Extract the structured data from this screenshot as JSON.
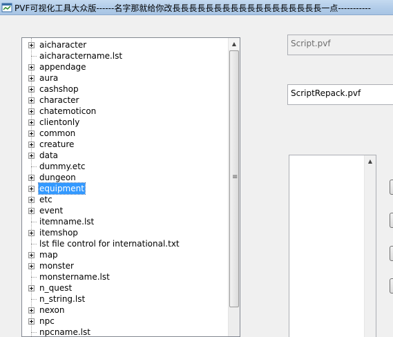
{
  "window": {
    "title": "PVF可视化工具大众版------名字那就给你改長長長長長長長長長長長長長長長長長長一点-----------"
  },
  "tree": {
    "items": [
      {
        "label": "aicharacter",
        "expandable": true,
        "selected": false
      },
      {
        "label": "aicharactername.lst",
        "expandable": false,
        "selected": false
      },
      {
        "label": "appendage",
        "expandable": true,
        "selected": false
      },
      {
        "label": "aura",
        "expandable": true,
        "selected": false
      },
      {
        "label": "cashshop",
        "expandable": true,
        "selected": false
      },
      {
        "label": "character",
        "expandable": true,
        "selected": false
      },
      {
        "label": "chatemoticon",
        "expandable": true,
        "selected": false
      },
      {
        "label": "clientonly",
        "expandable": true,
        "selected": false
      },
      {
        "label": "common",
        "expandable": true,
        "selected": false
      },
      {
        "label": "creature",
        "expandable": true,
        "selected": false
      },
      {
        "label": "data",
        "expandable": true,
        "selected": false
      },
      {
        "label": "dummy.etc",
        "expandable": false,
        "selected": false
      },
      {
        "label": "dungeon",
        "expandable": true,
        "selected": false
      },
      {
        "label": "equipment",
        "expandable": true,
        "selected": true
      },
      {
        "label": "etc",
        "expandable": true,
        "selected": false
      },
      {
        "label": "event",
        "expandable": true,
        "selected": false
      },
      {
        "label": "itemname.lst",
        "expandable": false,
        "selected": false
      },
      {
        "label": "itemshop",
        "expandable": true,
        "selected": false
      },
      {
        "label": "lst file control for international.txt",
        "expandable": false,
        "selected": false
      },
      {
        "label": "map",
        "expandable": true,
        "selected": false
      },
      {
        "label": "monster",
        "expandable": true,
        "selected": false
      },
      {
        "label": "monstername.lst",
        "expandable": false,
        "selected": false
      },
      {
        "label": "n_quest",
        "expandable": true,
        "selected": false
      },
      {
        "label": "n_string.lst",
        "expandable": false,
        "selected": false
      },
      {
        "label": "nexon",
        "expandable": true,
        "selected": false
      },
      {
        "label": "npc",
        "expandable": true,
        "selected": false
      },
      {
        "label": "npcname.lst",
        "expandable": false,
        "selected": false
      }
    ]
  },
  "fields": {
    "input_file": "Script.pvf",
    "output_file": "ScriptRepack.pvf"
  },
  "icons": {
    "app": "app-window-icon",
    "expand": "plus-box-icon",
    "scroll_up": "arrow-up-icon",
    "grip": "scroll-grip-icon"
  },
  "colors": {
    "selection": "#3399ff",
    "titlebar": "#b3cde9"
  }
}
